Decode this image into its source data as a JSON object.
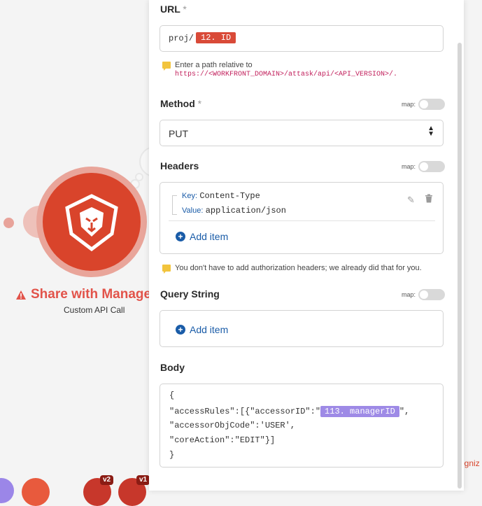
{
  "canvas": {
    "module_title": "Share with Manager",
    "module_subtitle": "Custom API Call",
    "version_badges": [
      "v2",
      "v1"
    ],
    "bg_right_text": "ogniz",
    "brand_color": "#d9442b"
  },
  "url": {
    "label": "URL",
    "required_mark": "*",
    "prefix": "proj/",
    "pill": "12. ID",
    "hint_line1": "Enter a path relative to",
    "hint_path": "https://<WORKFRONT_DOMAIN>/attask/api/<API_VERSION>/."
  },
  "method": {
    "label": "Method",
    "required_mark": "*",
    "map_label": "map:",
    "value": "PUT"
  },
  "headers": {
    "label": "Headers",
    "map_label": "map:",
    "items": [
      {
        "key_label": "Key:",
        "key": "Content-Type",
        "value_label": "Value:",
        "value": "application/json"
      }
    ],
    "add_item": "Add item",
    "hint": "You don't have to add authorization headers; we already did that for you."
  },
  "query_string": {
    "label": "Query String",
    "map_label": "map:",
    "add_item": "Add item"
  },
  "body": {
    "label": "Body",
    "line1": "{",
    "line2_prefix": "\"accessRules\":[{\"accessorID\":\"",
    "line2_pill": "113. managerID",
    "line2_suffix": "\",",
    "line3": "\"accessorObjCode\":'USER',",
    "line4": "\"coreAction\":\"EDIT\"}]",
    "line5": "}"
  }
}
